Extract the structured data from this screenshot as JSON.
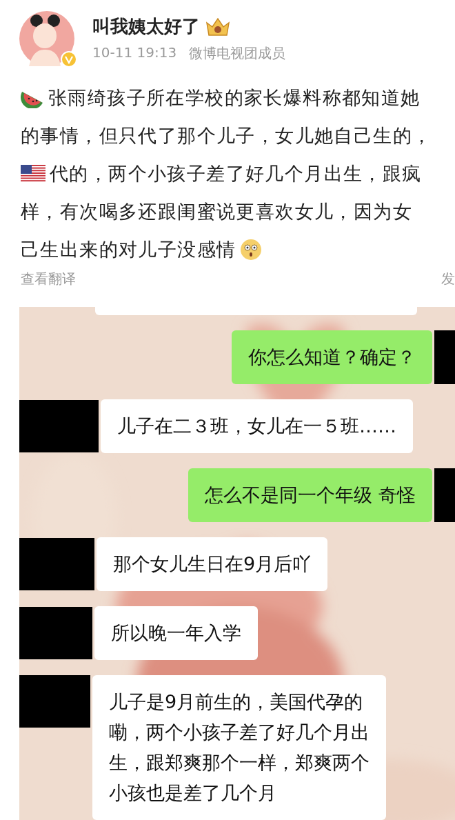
{
  "post": {
    "author": {
      "name": "叫我姨太好了",
      "verified": true,
      "crown": true
    },
    "time": "10-11 19:13",
    "source": "微博电视团成员",
    "body_lines": [
      {
        "parts": [
          {
            "kind": "watermelon"
          },
          {
            "kind": "text",
            "text": "张雨绮孩子所在学校的家长爆料称都知道她"
          }
        ]
      },
      {
        "parts": [
          {
            "kind": "text",
            "text": "的事情，但只代了那个儿子，女儿她自己生的，"
          }
        ]
      },
      {
        "parts": [
          {
            "kind": "flag"
          },
          {
            "kind": "text",
            "text": "代的，两个小孩子差了好几个月出生，跟疯"
          }
        ]
      },
      {
        "parts": [
          {
            "kind": "text",
            "text": "样，有次喝多还跟闺蜜说更喜欢女儿，因为女"
          }
        ]
      },
      {
        "parts": [
          {
            "kind": "text",
            "text": "己生出来的对儿子没感情"
          },
          {
            "kind": "surprised"
          }
        ]
      }
    ],
    "translate_link": "查看翻译",
    "publish_info": "发"
  },
  "chat": {
    "messages": [
      {
        "kind": "outgoing",
        "text": "你怎么知道？确定？"
      },
      {
        "kind": "incoming",
        "text": "儿子在二３班，女儿在一５班……"
      },
      {
        "kind": "outgoing",
        "text": "怎么不是同一个年级 奇怪"
      },
      {
        "kind": "incoming",
        "text": "那个女儿生日在9月后吖"
      },
      {
        "kind": "incoming",
        "text": "所以晚一年入学"
      },
      {
        "kind": "incoming",
        "text": "儿子是9月前生的，美国代孕的嘞，两个小孩子差了好几个月出生，跟郑爽那个一样，郑爽两个小孩也是差了几个月"
      }
    ]
  }
}
